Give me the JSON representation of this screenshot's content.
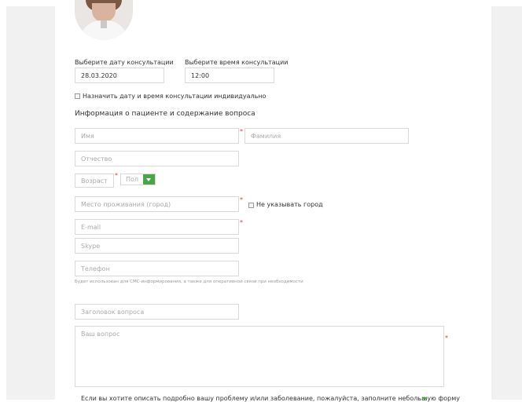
{
  "consultation": {
    "date_label": "Выберите дату консультации",
    "date_value": "28.03.2020",
    "time_label": "Выберите время консультации",
    "time_value": "12:00",
    "individual_checkbox_label": "Назначить дату и время консультации индивидуально"
  },
  "patient_section": {
    "title": "Информация о пациенте и содержание вопроса",
    "first_name_placeholder": "Имя",
    "last_name_placeholder": "Фамилия",
    "patronymic_placeholder": "Отчество",
    "age_placeholder": "Возраст",
    "gender_select_value": "Пол",
    "city_placeholder": "Место проживания (город)",
    "no_city_checkbox_label": "Не указывать город",
    "email_placeholder": "E-mail",
    "skype_placeholder": "Skype",
    "phone_placeholder": "Телефон",
    "phone_note": "Будет использован для СМС-информирования, а также для оперативной связи при необходимости"
  },
  "question_section": {
    "title_placeholder": "Заголовок вопроса",
    "question_placeholder": "Ваш вопрос"
  },
  "footer": {
    "detailed_form_prompt": "Если вы хотите описать подробно вашу проблему и/или заболевание, пожалуйста, заполните небольшую форму"
  },
  "required_marker": "*",
  "colors": {
    "accent_green": "#4aa54a",
    "required_red": "#e23b3b",
    "side_gray": "#f1f1f1"
  }
}
